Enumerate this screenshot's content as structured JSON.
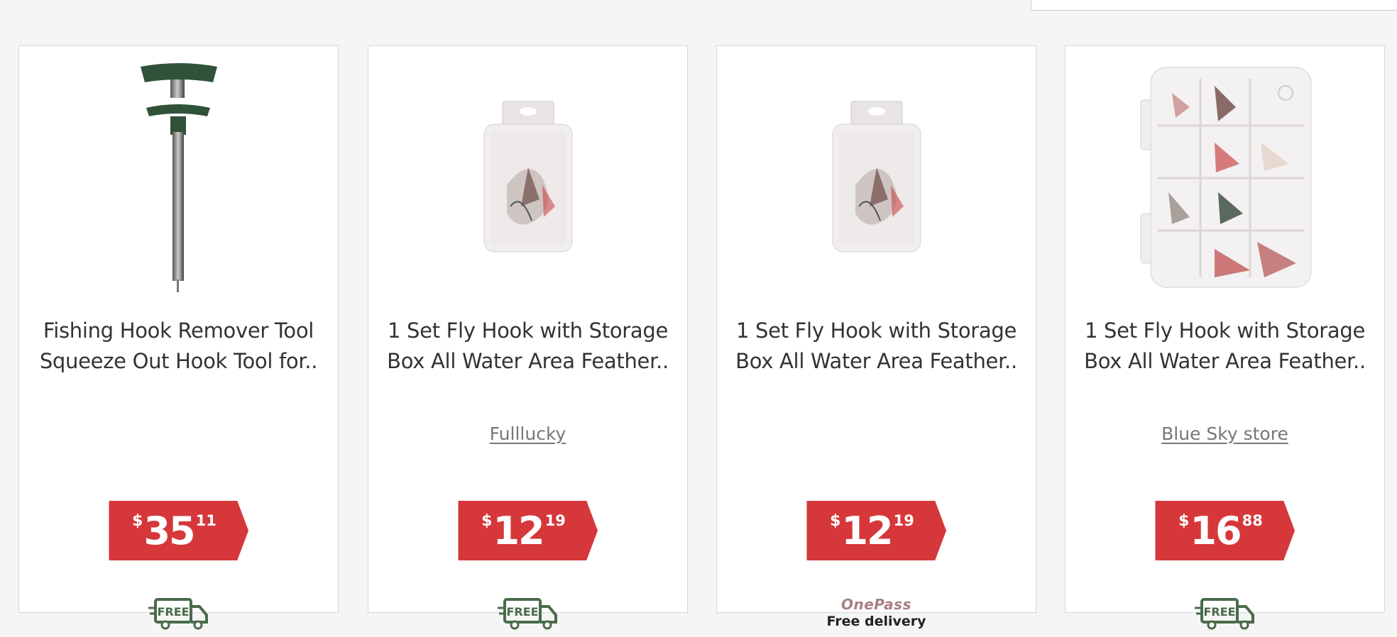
{
  "products": [
    {
      "title": "Fishing Hook Remover Tool Squeeze Out Hook Tool for..",
      "seller": "",
      "price": {
        "currency": "$",
        "dollars": "35",
        "cents": "11"
      },
      "delivery": {
        "badge": "FREE"
      }
    },
    {
      "title": "1 Set Fly Hook with Storage Box All Water Area Feather..",
      "seller": "Fulllucky",
      "price": {
        "currency": "$",
        "dollars": "12",
        "cents": "19"
      },
      "delivery": {
        "badge": "FREE"
      }
    },
    {
      "title": "1 Set Fly Hook with Storage Box All Water Area Feather..",
      "seller": "",
      "price": {
        "currency": "$",
        "dollars": "12",
        "cents": "19"
      },
      "delivery": {
        "onepass_logo": "OnePass",
        "onepass_text": "Free delivery"
      }
    },
    {
      "title": "1 Set Fly Hook with Storage Box All Water Area Feather..",
      "seller": "Blue Sky store",
      "price": {
        "currency": "$",
        "dollars": "16",
        "cents": "88"
      },
      "delivery": {
        "badge": "FREE"
      }
    }
  ],
  "colors": {
    "price_tag": "#d6373a",
    "free_badge": "#4a6b4a",
    "onepass": "#a77f80"
  },
  "icons": {
    "free_delivery": "free-delivery-truck-icon"
  }
}
